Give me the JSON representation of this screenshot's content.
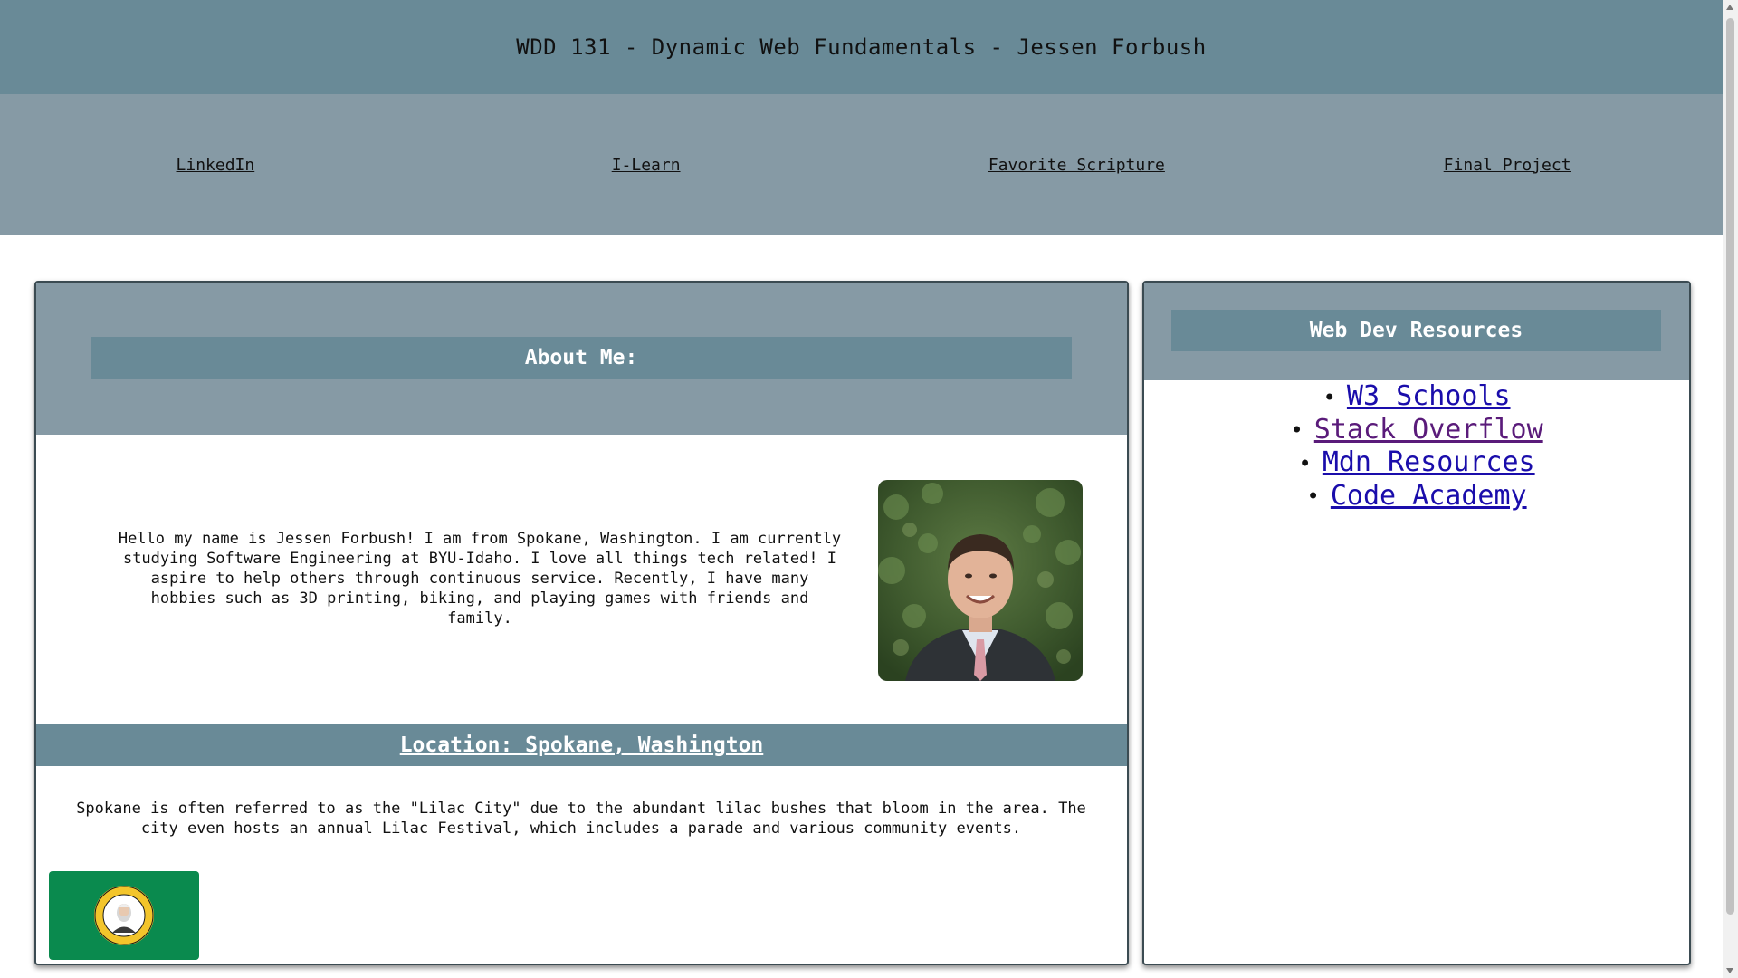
{
  "header": {
    "title": "WDD 131 - Dynamic Web Fundamentals - Jessen Forbush"
  },
  "nav": {
    "items": [
      {
        "label": "LinkedIn"
      },
      {
        "label": "I-Learn"
      },
      {
        "label": "Favorite Scripture"
      },
      {
        "label": "Final Project"
      }
    ]
  },
  "about": {
    "heading": "About Me:",
    "text": "Hello my name is Jessen Forbush! I am from Spokane, Washington. I am currently studying Software Engineering at BYU-Idaho. I love all things tech related! I aspire to help others through continuous service. Recently, I have many hobbies such as 3D printing, biking, and playing games with friends and family.",
    "location_heading": "Location: Spokane, Washington",
    "location_text": "Spokane is often referred to as the \"Lilac City\" due to the abundant lilac bushes that bloom in the area. The city even hosts an annual Lilac Festival, which includes a parade and various community events."
  },
  "resources": {
    "heading": "Web Dev Resources",
    "links": [
      {
        "label": "W3 Schools"
      },
      {
        "label": "Stack Overflow"
      },
      {
        "label": "Mdn Resources"
      },
      {
        "label": "Code Academy"
      }
    ]
  },
  "colors": {
    "header_bg": "#698a97",
    "nav_bg": "#869aa5",
    "link": "#1a0dab",
    "visited_link": "#5a1b7a",
    "flag_green": "#0a8a4e"
  },
  "images": {
    "portrait": "profile-photo",
    "flag": "washington-state-flag"
  }
}
